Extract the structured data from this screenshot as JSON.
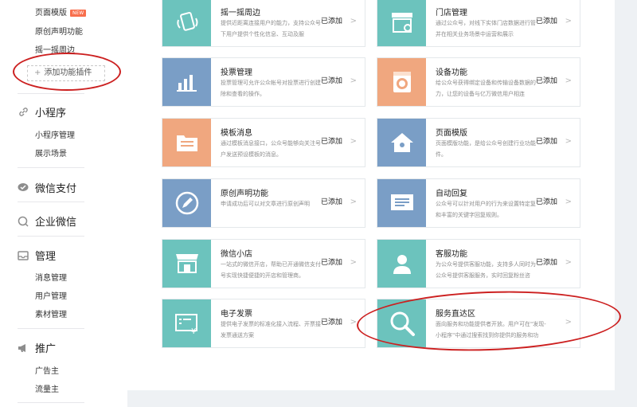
{
  "sidebar": {
    "items_top": [
      {
        "label": "页面模版",
        "badge": "NEW"
      },
      {
        "label": "原创声明功能"
      },
      {
        "label": "摇一摇周边"
      }
    ],
    "add_plugin": "添加功能插件",
    "sections": [
      {
        "label": "小程序",
        "icon": "link-icon",
        "children": [
          "小程序管理",
          "展示场景"
        ]
      },
      {
        "label": "微信支付",
        "icon": "wechat-pay-icon",
        "children": []
      },
      {
        "label": "企业微信",
        "icon": "enterprise-wechat-icon",
        "children": []
      },
      {
        "label": "管理",
        "icon": "inbox-icon",
        "children": [
          "消息管理",
          "用户管理",
          "素材管理"
        ]
      },
      {
        "label": "推广",
        "icon": "megaphone-icon",
        "children": [
          "广告主",
          "流量主"
        ]
      }
    ]
  },
  "cards": [
    {
      "title": "摇一摇周边",
      "desc": "提供近距离连接用户的能力，支持公众号为线下用户提供个性化信息、互动及服",
      "added": "已添加",
      "icon": "shake-phone-icon",
      "color": "#6cc3bd"
    },
    {
      "title": "门店管理",
      "desc": "通过公众号，对线下实体门店数据进行管理，并在相关业务场景中运营和展示",
      "added": "已添加",
      "icon": "store-icon",
      "color": "#6cc3bd"
    },
    {
      "title": "投票管理",
      "desc": "投票管理可允许公众帐号对投票进行创建、删除和查看的操作。",
      "added": "已添加",
      "icon": "bar-chart-icon",
      "color": "#7a9ec6"
    },
    {
      "title": "设备功能",
      "desc": "给公众号获得绑定设备和传输设备数据的能力，让您的设备与亿万微信用户相连",
      "added": "已添加",
      "icon": "washing-machine-icon",
      "color": "#f0a77f"
    },
    {
      "title": "模板消息",
      "desc": "通过模板消息接口，公众号能够向关注号的用户发送预设模板的消息。",
      "added": "已添加",
      "icon": "folder-icon",
      "color": "#f0a77f"
    },
    {
      "title": "页面模版",
      "desc": "页面模版功能，是给公众号创建行业功能插件。",
      "added": "已添加",
      "icon": "home-icon",
      "color": "#7a9ec6"
    },
    {
      "title": "原创声明功能",
      "desc": "申请成功后可以对文章进行原创声明",
      "added": "已添加",
      "icon": "pencil-circle-icon",
      "color": "#7a9ec6"
    },
    {
      "title": "自动回复",
      "desc": "公众号可以针对用户的行为来设置特定复内容和丰富的关键字回复规则。",
      "added": "已添加",
      "icon": "message-icon",
      "color": "#7a9ec6"
    },
    {
      "title": "微信小店",
      "desc": "一站式的微信开店，帮助已开通微信支付公众号实现快捷便捷的开店和管理商。",
      "added": "已添加",
      "icon": "shop-icon",
      "color": "#6cc3bd"
    },
    {
      "title": "客服功能",
      "desc": "为公众号提供客服功能，支持多人同时为一个公众号提供客服服务，实时回复粉丝咨",
      "added": "已添加",
      "icon": "customer-service-icon",
      "color": "#6cc3bd"
    },
    {
      "title": "电子发票",
      "desc": "提供电子发票的标准化接入流程、开票接口和发票通送方案",
      "added": "已添加",
      "icon": "invoice-icon",
      "color": "#6cc3bd"
    },
    {
      "title": "服务直达区",
      "desc": "面向服务和功能提供者开放。用户可在\"发现-小程序\"中通过搜索找到你提供的服务和功",
      "added": "",
      "icon": "search-icon",
      "color": "#6cc3bd"
    }
  ],
  "colors": {
    "teal": "#6cc3bd",
    "blue": "#7a9ec6",
    "orange": "#f0a77f",
    "annotation": "#cc2020"
  }
}
